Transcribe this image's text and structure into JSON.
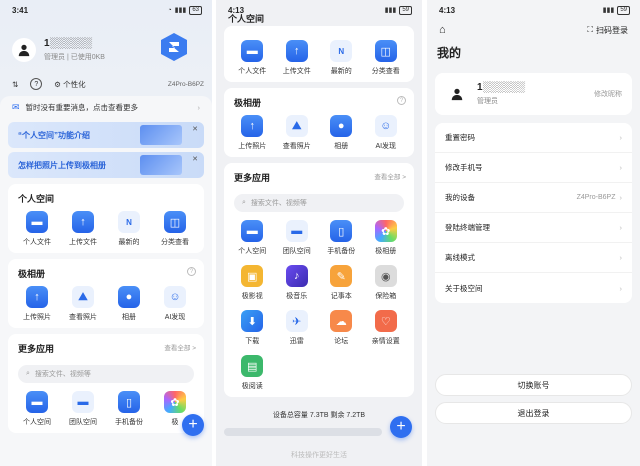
{
  "panel1": {
    "status": {
      "time": "3:41",
      "battery": "63"
    },
    "user": {
      "name": "1░░░░░░",
      "role": "管理员 | 已使用0KB"
    },
    "tools": {
      "personalize": "个性化",
      "device": "Z4Pro-B6PZ"
    },
    "notice": "暂时没有重要消息，点击查看更多",
    "banners": [
      "“个人空间”功能介绍",
      "怎样把照片上传到极相册"
    ],
    "personal_space": {
      "title": "个人空间",
      "items": [
        "个人文件",
        "上传文件",
        "最新的",
        "分类查看"
      ]
    },
    "album": {
      "title": "极相册",
      "items": [
        "上传照片",
        "查看照片",
        "相册",
        "AI发现"
      ]
    },
    "more_apps": {
      "title": "更多应用",
      "more": "查看全部 >",
      "search_placeholder": "搜索文件、视频等",
      "items": [
        "个人空间",
        "团队空间",
        "手机备份",
        "极"
      ]
    }
  },
  "panel2": {
    "status": {
      "time": "4:13",
      "battery": "59"
    },
    "top_title": "个人空间",
    "personal_items": [
      "个人文件",
      "上传文件",
      "最新的",
      "分类查看"
    ],
    "album": {
      "title": "极相册",
      "items": [
        "上传照片",
        "查看照片",
        "相册",
        "AI发现"
      ]
    },
    "more_apps": {
      "title": "更多应用",
      "more": "查看全部 >",
      "search_placeholder": "搜索文件、视频等",
      "items": [
        "个人空间",
        "团队空间",
        "手机备份",
        "极相册",
        "极影视",
        "极音乐",
        "记事本",
        "保险箱",
        "下载",
        "迅雷",
        "论坛",
        "亲情设置",
        "极阅读"
      ]
    },
    "storage": "设备总容量 7.3TB  剩余 7.2TB",
    "footer": "科技操作更好生活"
  },
  "panel3": {
    "status": {
      "time": "4:13",
      "battery": "59"
    },
    "scan": "扫码登录",
    "title": "我的",
    "user": {
      "name": "1░░░░░░",
      "role": "管理员",
      "edit": "修改昵称"
    },
    "rows": [
      {
        "label": "重置密码",
        "value": ""
      },
      {
        "label": "修改手机号",
        "value": ""
      },
      {
        "label": "我的设备",
        "value": "Z4Pro-B6PZ"
      },
      {
        "label": "登陆终端管理",
        "value": ""
      },
      {
        "label": "离线模式",
        "value": ""
      },
      {
        "label": "关于极空间",
        "value": ""
      }
    ],
    "switch_account": "切换账号",
    "logout": "退出登录"
  }
}
